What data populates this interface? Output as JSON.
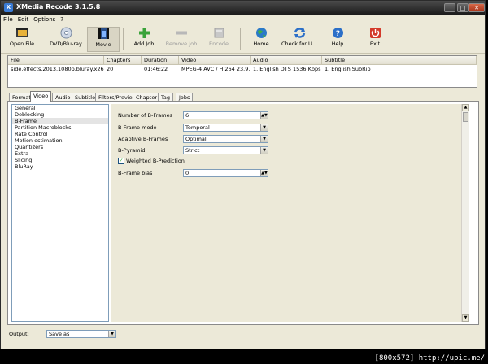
{
  "window": {
    "title": "XMedia Recode 3.1.5.8",
    "controls": [
      "_",
      "□",
      "✕"
    ]
  },
  "menu": [
    "File",
    "Edit",
    "Options",
    "?"
  ],
  "toolbar": {
    "open_file": "Open File",
    "dvd": "DVD/Blu-ray",
    "movie": "Movie",
    "add_job": "Add Job",
    "remove_job": "Remove Job",
    "encode": "Encode",
    "home": "Home",
    "check_updates": "Check for U...",
    "help": "Help",
    "exit": "Exit"
  },
  "joblist": {
    "headers": [
      "File",
      "Chapters",
      "Duration",
      "Video",
      "Audio",
      "Subtitle"
    ],
    "row": [
      "side.effects.2013.1080p.bluray.x26...",
      "20",
      "01:46:22",
      "MPEG-4 AVC / H.264 23.9...",
      "1. English DTS 1536 Kbps ...",
      "1. English SubRip"
    ]
  },
  "tabs": [
    "Format",
    "Video",
    "Audio",
    "Subtitle",
    "Filters/Preview",
    "Chapter",
    "Tag",
    "Jobs"
  ],
  "active_tab": "Video",
  "nav": [
    "General",
    "Deblocking",
    "B-Frame",
    "Partition Macroblocks",
    "Rate Control",
    "Motion estimation",
    "Quantizers",
    "Extra",
    "Slicing",
    "BluRay"
  ],
  "nav_selected": "B-Frame",
  "settings": {
    "num_bframes_label": "Number of B-Frames",
    "num_bframes_value": "6",
    "bframe_mode_label": "B-Frame mode",
    "bframe_mode_value": "Temporal",
    "adaptive_label": "Adaptive B-Frames",
    "adaptive_value": "Optimal",
    "pyramid_label": "B-Pyramid",
    "pyramid_value": "Strict",
    "weighted_label": "Weighted B-Prediction",
    "weighted_checked": true,
    "bias_label": "B-Frame bias",
    "bias_value": "0"
  },
  "output": {
    "label": "Output:",
    "value": "Save as"
  },
  "watermark": "[800x572] http://upic.me/"
}
